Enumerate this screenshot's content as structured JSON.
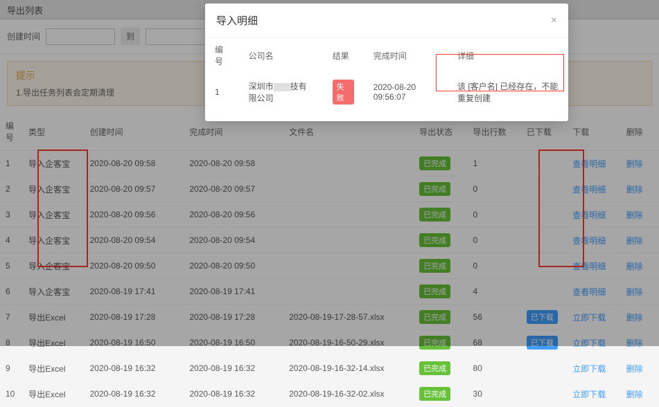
{
  "topbar": {
    "title": "导出列表"
  },
  "filter": {
    "label": "创建时间",
    "to": "到"
  },
  "notice": {
    "title": "提示",
    "text": "1.导出任务列表会定期清理"
  },
  "headers": {
    "id": "编号",
    "type": "类型",
    "create": "创建时间",
    "finish": "完成时间",
    "file": "文件名",
    "status": "导出状态",
    "rows": "导出行数",
    "downloaded": "已下载",
    "download": "下载",
    "delete": "删除"
  },
  "labels": {
    "done": "已完成",
    "downloaded": "已下载",
    "view": "查看明细",
    "dlnow": "立即下载",
    "delete": "删除"
  },
  "rows": [
    {
      "id": "1",
      "type": "导入企客宝",
      "create": "2020-08-20 09:58",
      "finish": "2020-08-20 09:58",
      "file": "",
      "rows": "1",
      "dl": "",
      "link": "view"
    },
    {
      "id": "2",
      "type": "导入企客宝",
      "create": "2020-08-20 09:57",
      "finish": "2020-08-20 09:57",
      "file": "",
      "rows": "0",
      "dl": "",
      "link": "view"
    },
    {
      "id": "3",
      "type": "导入企客宝",
      "create": "2020-08-20 09:56",
      "finish": "2020-08-20 09:56",
      "file": "",
      "rows": "0",
      "dl": "",
      "link": "view"
    },
    {
      "id": "4",
      "type": "导入企客宝",
      "create": "2020-08-20 09:54",
      "finish": "2020-08-20 09:54",
      "file": "",
      "rows": "0",
      "dl": "",
      "link": "view"
    },
    {
      "id": "5",
      "type": "导入企客宝",
      "create": "2020-08-20 09:50",
      "finish": "2020-08-20 09:50",
      "file": "",
      "rows": "0",
      "dl": "",
      "link": "view"
    },
    {
      "id": "6",
      "type": "导入企客宝",
      "create": "2020-08-19 17:41",
      "finish": "2020-08-19 17:41",
      "file": "",
      "rows": "4",
      "dl": "",
      "link": "view"
    },
    {
      "id": "7",
      "type": "导出Excel",
      "create": "2020-08-19 17:28",
      "finish": "2020-08-19 17:28",
      "file": "2020-08-19-17-28-57.xlsx",
      "rows": "56",
      "dl": "yes",
      "link": "dl"
    },
    {
      "id": "8",
      "type": "导出Excel",
      "create": "2020-08-19 16:50",
      "finish": "2020-08-19 16:50",
      "file": "2020-08-19-16-50-29.xlsx",
      "rows": "68",
      "dl": "yes",
      "link": "dl"
    },
    {
      "id": "9",
      "type": "导出Excel",
      "create": "2020-08-19 16:32",
      "finish": "2020-08-19 16:32",
      "file": "2020-08-19-16-32-14.xlsx",
      "rows": "80",
      "dl": "",
      "link": "dl"
    },
    {
      "id": "10",
      "type": "导出Excel",
      "create": "2020-08-19 16:32",
      "finish": "2020-08-19 16:32",
      "file": "2020-08-19-16-32-02.xlsx",
      "rows": "30",
      "dl": "",
      "link": "dl"
    }
  ],
  "modal": {
    "title": "导入明细",
    "headers": {
      "id": "编号",
      "company": "公司名",
      "result": "结果",
      "finish": "完成时间",
      "detail": "详细"
    },
    "row": {
      "id": "1",
      "company_pre": "深圳市",
      "company_post": "技有限公司",
      "result": "失败",
      "finish": "2020-08-20 09:56:07",
      "detail": "该 [客户名] 已经存在，不能重复创建"
    }
  }
}
